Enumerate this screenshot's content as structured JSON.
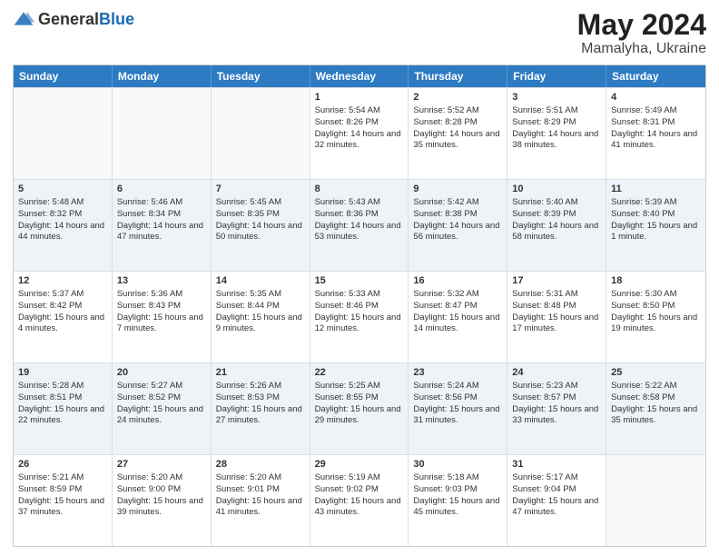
{
  "header": {
    "logo_general": "General",
    "logo_blue": "Blue",
    "month_year": "May 2024",
    "location": "Mamalyha, Ukraine"
  },
  "days_of_week": [
    "Sunday",
    "Monday",
    "Tuesday",
    "Wednesday",
    "Thursday",
    "Friday",
    "Saturday"
  ],
  "weeks": [
    [
      {
        "day": "",
        "info": ""
      },
      {
        "day": "",
        "info": ""
      },
      {
        "day": "",
        "info": ""
      },
      {
        "day": "1",
        "info": "Sunrise: 5:54 AM\nSunset: 8:26 PM\nDaylight: 14 hours and 32 minutes."
      },
      {
        "day": "2",
        "info": "Sunrise: 5:52 AM\nSunset: 8:28 PM\nDaylight: 14 hours and 35 minutes."
      },
      {
        "day": "3",
        "info": "Sunrise: 5:51 AM\nSunset: 8:29 PM\nDaylight: 14 hours and 38 minutes."
      },
      {
        "day": "4",
        "info": "Sunrise: 5:49 AM\nSunset: 8:31 PM\nDaylight: 14 hours and 41 minutes."
      }
    ],
    [
      {
        "day": "5",
        "info": "Sunrise: 5:48 AM\nSunset: 8:32 PM\nDaylight: 14 hours and 44 minutes."
      },
      {
        "day": "6",
        "info": "Sunrise: 5:46 AM\nSunset: 8:34 PM\nDaylight: 14 hours and 47 minutes."
      },
      {
        "day": "7",
        "info": "Sunrise: 5:45 AM\nSunset: 8:35 PM\nDaylight: 14 hours and 50 minutes."
      },
      {
        "day": "8",
        "info": "Sunrise: 5:43 AM\nSunset: 8:36 PM\nDaylight: 14 hours and 53 minutes."
      },
      {
        "day": "9",
        "info": "Sunrise: 5:42 AM\nSunset: 8:38 PM\nDaylight: 14 hours and 56 minutes."
      },
      {
        "day": "10",
        "info": "Sunrise: 5:40 AM\nSunset: 8:39 PM\nDaylight: 14 hours and 58 minutes."
      },
      {
        "day": "11",
        "info": "Sunrise: 5:39 AM\nSunset: 8:40 PM\nDaylight: 15 hours and 1 minute."
      }
    ],
    [
      {
        "day": "12",
        "info": "Sunrise: 5:37 AM\nSunset: 8:42 PM\nDaylight: 15 hours and 4 minutes."
      },
      {
        "day": "13",
        "info": "Sunrise: 5:36 AM\nSunset: 8:43 PM\nDaylight: 15 hours and 7 minutes."
      },
      {
        "day": "14",
        "info": "Sunrise: 5:35 AM\nSunset: 8:44 PM\nDaylight: 15 hours and 9 minutes."
      },
      {
        "day": "15",
        "info": "Sunrise: 5:33 AM\nSunset: 8:46 PM\nDaylight: 15 hours and 12 minutes."
      },
      {
        "day": "16",
        "info": "Sunrise: 5:32 AM\nSunset: 8:47 PM\nDaylight: 15 hours and 14 minutes."
      },
      {
        "day": "17",
        "info": "Sunrise: 5:31 AM\nSunset: 8:48 PM\nDaylight: 15 hours and 17 minutes."
      },
      {
        "day": "18",
        "info": "Sunrise: 5:30 AM\nSunset: 8:50 PM\nDaylight: 15 hours and 19 minutes."
      }
    ],
    [
      {
        "day": "19",
        "info": "Sunrise: 5:28 AM\nSunset: 8:51 PM\nDaylight: 15 hours and 22 minutes."
      },
      {
        "day": "20",
        "info": "Sunrise: 5:27 AM\nSunset: 8:52 PM\nDaylight: 15 hours and 24 minutes."
      },
      {
        "day": "21",
        "info": "Sunrise: 5:26 AM\nSunset: 8:53 PM\nDaylight: 15 hours and 27 minutes."
      },
      {
        "day": "22",
        "info": "Sunrise: 5:25 AM\nSunset: 8:55 PM\nDaylight: 15 hours and 29 minutes."
      },
      {
        "day": "23",
        "info": "Sunrise: 5:24 AM\nSunset: 8:56 PM\nDaylight: 15 hours and 31 minutes."
      },
      {
        "day": "24",
        "info": "Sunrise: 5:23 AM\nSunset: 8:57 PM\nDaylight: 15 hours and 33 minutes."
      },
      {
        "day": "25",
        "info": "Sunrise: 5:22 AM\nSunset: 8:58 PM\nDaylight: 15 hours and 35 minutes."
      }
    ],
    [
      {
        "day": "26",
        "info": "Sunrise: 5:21 AM\nSunset: 8:59 PM\nDaylight: 15 hours and 37 minutes."
      },
      {
        "day": "27",
        "info": "Sunrise: 5:20 AM\nSunset: 9:00 PM\nDaylight: 15 hours and 39 minutes."
      },
      {
        "day": "28",
        "info": "Sunrise: 5:20 AM\nSunset: 9:01 PM\nDaylight: 15 hours and 41 minutes."
      },
      {
        "day": "29",
        "info": "Sunrise: 5:19 AM\nSunset: 9:02 PM\nDaylight: 15 hours and 43 minutes."
      },
      {
        "day": "30",
        "info": "Sunrise: 5:18 AM\nSunset: 9:03 PM\nDaylight: 15 hours and 45 minutes."
      },
      {
        "day": "31",
        "info": "Sunrise: 5:17 AM\nSunset: 9:04 PM\nDaylight: 15 hours and 47 minutes."
      },
      {
        "day": "",
        "info": ""
      }
    ]
  ]
}
